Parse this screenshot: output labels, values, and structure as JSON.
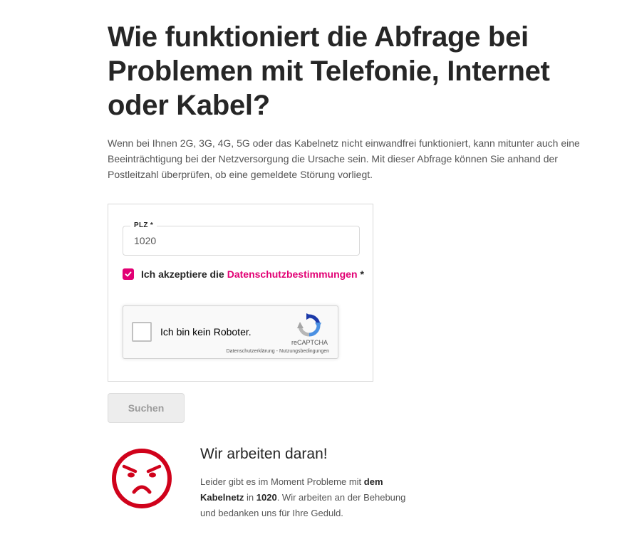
{
  "heading": {
    "title": "Wie funktioniert die Abfrage bei Problemen mit Telefonie, Internet oder Kabel?",
    "intro": "Wenn bei Ihnen 2G, 3G, 4G, 5G oder das Kabelnetz nicht einwandfrei funktioniert, kann mitunter auch eine Beeinträchtigung bei der Netzversorgung die Ursache sein. Mit dieser Abfrage können Sie anhand der Postleitzahl überprüfen, ob eine gemeldete Störung vorliegt."
  },
  "form": {
    "plz_label": "PLZ *",
    "plz_value": "1020",
    "consent_checked": true,
    "consent_prefix": "Ich akzeptiere die",
    "consent_link": "Datenschutzbestimmungen",
    "consent_suffix": "*",
    "recaptcha": {
      "label": "Ich bin kein Roboter.",
      "brand": "reCAPTCHA",
      "privacy_link": "Datenschutzerklärung",
      "separator": "-",
      "terms_link": "Nutzungsbedingungen"
    },
    "search_button": "Suchen"
  },
  "status": {
    "icon": "sad-face-icon",
    "title": "Wir arbeiten daran!",
    "text_1": "Leider gibt es im Moment Probleme mit",
    "bold_1": "dem Kabelnetz",
    "text_2": "in",
    "bold_2": "1020",
    "text_3": ". Wir arbeiten an der Behebung und bedanken uns für Ihre Geduld."
  },
  "colors": {
    "accent": "#e20074",
    "error": "#d0021b",
    "text": "#262626",
    "muted": "#555555"
  }
}
